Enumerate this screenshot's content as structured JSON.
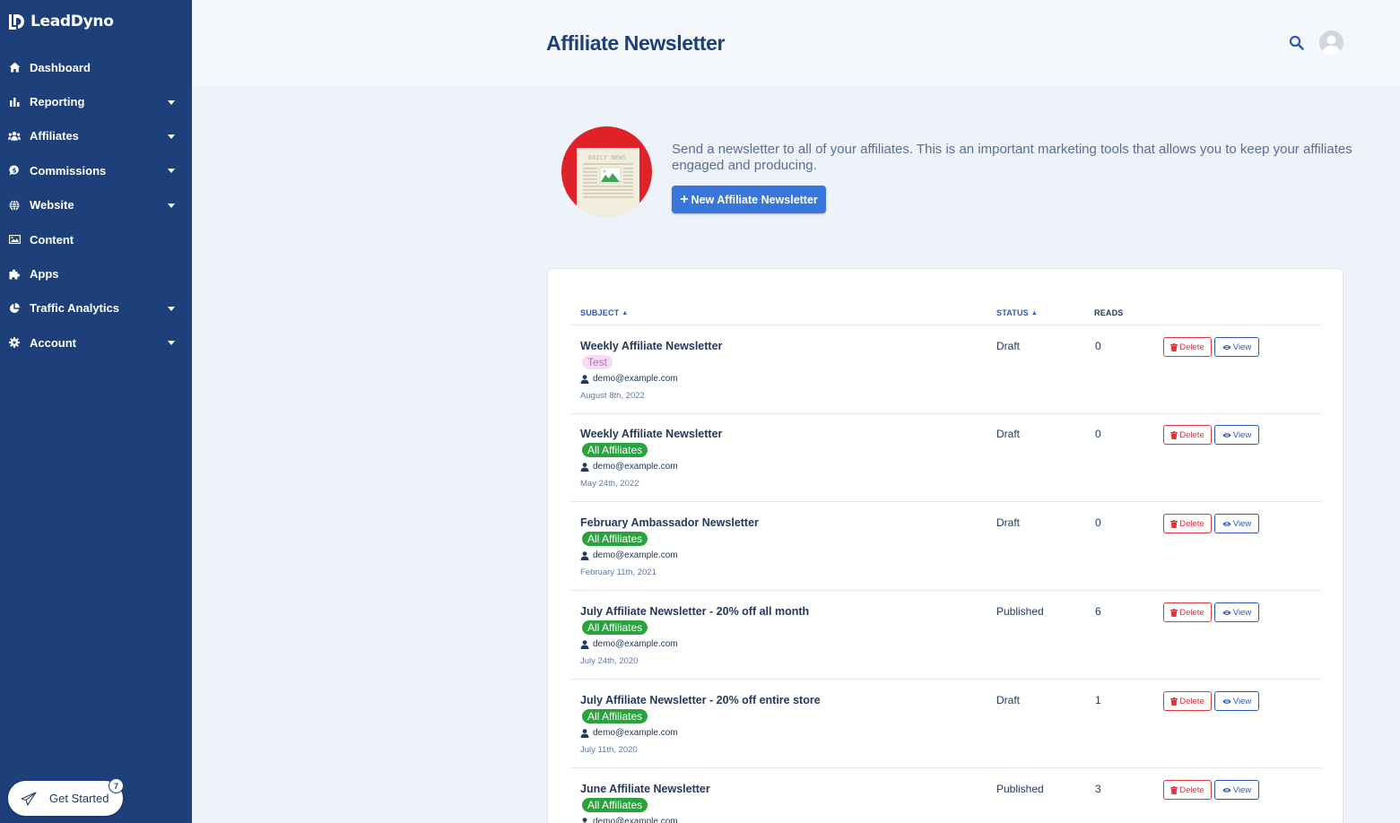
{
  "app": {
    "brand": "LeadDyno"
  },
  "sidebar": {
    "items": [
      {
        "label": "Dashboard",
        "icon": "home-icon",
        "has_submenu": false
      },
      {
        "label": "Reporting",
        "icon": "bar-chart-icon",
        "has_submenu": true
      },
      {
        "label": "Affiliates",
        "icon": "users-icon",
        "has_submenu": true
      },
      {
        "label": "Commissions",
        "icon": "dollar-bubble-icon",
        "has_submenu": true
      },
      {
        "label": "Website",
        "icon": "globe-icon",
        "has_submenu": true
      },
      {
        "label": "Content",
        "icon": "image-icon",
        "has_submenu": false
      },
      {
        "label": "Apps",
        "icon": "puzzle-icon",
        "has_submenu": false
      },
      {
        "label": "Traffic Analytics",
        "icon": "pie-chart-icon",
        "has_submenu": true
      },
      {
        "label": "Account",
        "icon": "gear-icon",
        "has_submenu": true
      }
    ],
    "get_started": {
      "label": "Get Started",
      "badge": "7"
    }
  },
  "header": {
    "title": "Affiliate Newsletter"
  },
  "hero": {
    "description": "Send a newsletter to all of your affiliates. This is an important marketing tools that allows you to keep your affiliates engaged and producing.",
    "new_button_label": "New Affiliate Newsletter",
    "illustration_text": "DAILY NEWS"
  },
  "table": {
    "columns": {
      "subject": "SUBJECT",
      "status": "STATUS",
      "reads": "READS"
    },
    "delete_label": "Delete",
    "view_label": "View",
    "rows": [
      {
        "subject": "Weekly Affiliate Newsletter",
        "audience": "Test",
        "audience_type": "test",
        "author": "demo@example.com",
        "date": "August 8th, 2022",
        "status": "Draft",
        "reads": "0"
      },
      {
        "subject": "Weekly Affiliate Newsletter",
        "audience": "All Affiliates",
        "audience_type": "all",
        "author": "demo@example.com",
        "date": "May 24th, 2022",
        "status": "Draft",
        "reads": "0"
      },
      {
        "subject": "February Ambassador Newsletter",
        "audience": "All Affiliates",
        "audience_type": "all",
        "author": "demo@example.com",
        "date": "February 11th, 2021",
        "status": "Draft",
        "reads": "0"
      },
      {
        "subject": "July Affiliate Newsletter - 20% off all month",
        "audience": "All Affiliates",
        "audience_type": "all",
        "author": "demo@example.com",
        "date": "July 24th, 2020",
        "status": "Published",
        "reads": "6"
      },
      {
        "subject": "July Affiliate Newsletter - 20% off entire store",
        "audience": "All Affiliates",
        "audience_type": "all",
        "author": "demo@example.com",
        "date": "July 11th, 2020",
        "status": "Draft",
        "reads": "1"
      },
      {
        "subject": "June Affiliate Newsletter",
        "audience": "All Affiliates",
        "audience_type": "all",
        "author": "demo@example.com",
        "date": "",
        "status": "Published",
        "reads": "3"
      }
    ]
  },
  "colors": {
    "sidebar_bg": "#1d3f7a",
    "primary_button": "#3876db",
    "delete": "#d9363e",
    "view": "#2d5bb5",
    "tag_all": "#2aa33e",
    "tag_test": "#f6dcf3"
  }
}
